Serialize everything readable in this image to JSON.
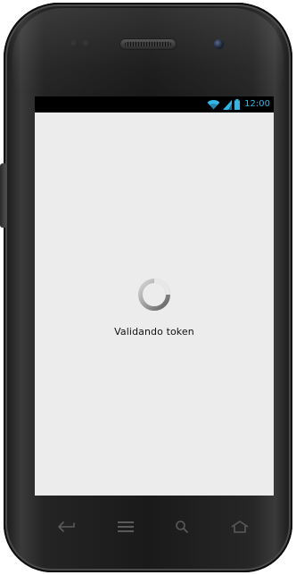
{
  "status_bar": {
    "time": "12:00",
    "icons": [
      "wifi-icon",
      "signal-icon",
      "battery-icon"
    ],
    "clock_color": "#33b5e5"
  },
  "main": {
    "loading_text": "Validando token",
    "spinner_icon": "loading-spinner-icon"
  },
  "hardware_keys": [
    "back-icon",
    "menu-icon",
    "search-icon",
    "home-icon"
  ],
  "colors": {
    "screen_background": "#ececec",
    "status_bar_background": "#000000",
    "text": "#111111"
  }
}
